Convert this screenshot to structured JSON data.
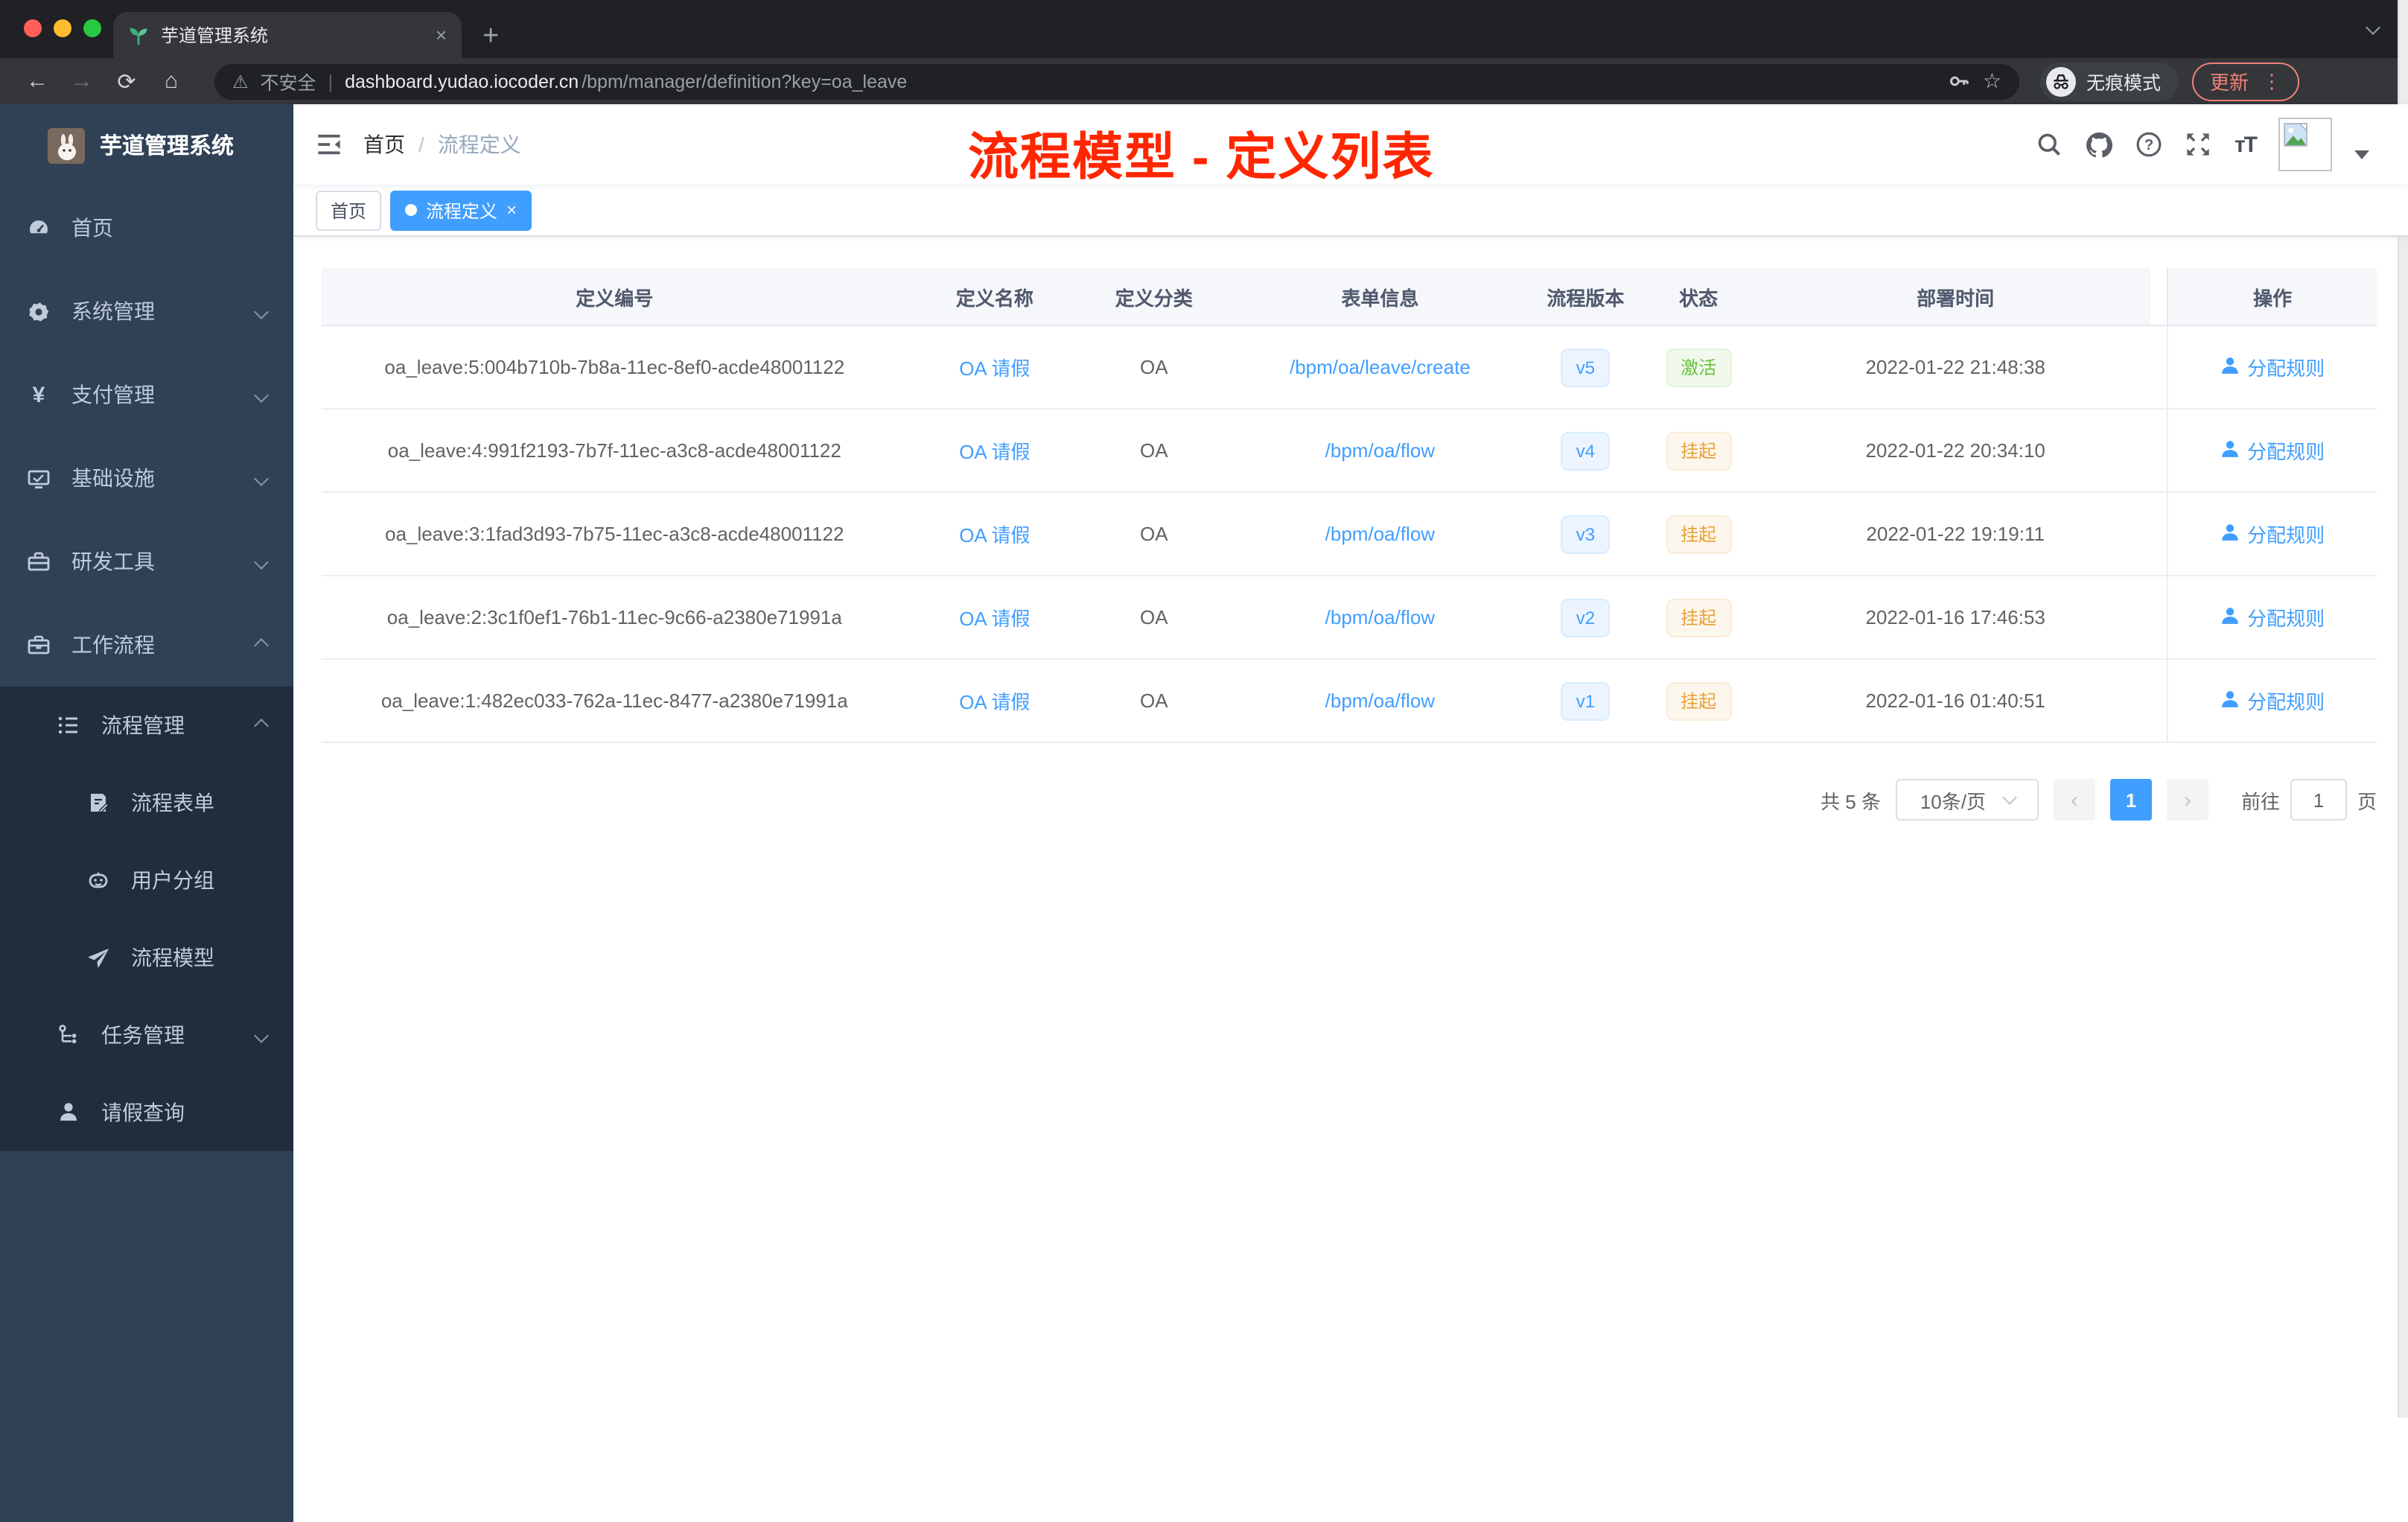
{
  "browser": {
    "tab": {
      "title": "芋道管理系统",
      "close": "×",
      "new_tab": "+"
    },
    "address": {
      "security": "不安全",
      "host": "dashboard.yudao.iocoder.cn",
      "path": "/bpm/manager/definition?key=oa_leave",
      "incognito": "无痕模式",
      "update": "更新",
      "menu_dots": "⋮",
      "star": "☆",
      "warn": "⚠",
      "back": "←",
      "forward": "→",
      "reload": "⟳",
      "home": "⌂"
    }
  },
  "sidebar": {
    "title": "芋道管理系统",
    "items": [
      {
        "label": "首页",
        "icon": "dashboard-icon"
      },
      {
        "label": "系统管理",
        "icon": "gear-icon"
      },
      {
        "label": "支付管理",
        "icon": "yen-icon"
      },
      {
        "label": "基础设施",
        "icon": "monitor-icon"
      },
      {
        "label": "研发工具",
        "icon": "toolbox-icon"
      },
      {
        "label": "工作流程",
        "icon": "briefcase-icon"
      },
      {
        "label": "流程管理",
        "icon": "list-icon"
      },
      {
        "label": "流程表单",
        "icon": "form-icon"
      },
      {
        "label": "用户分组",
        "icon": "robot-icon"
      },
      {
        "label": "流程模型",
        "icon": "paper-plane-icon"
      },
      {
        "label": "任务管理",
        "icon": "tree-icon"
      },
      {
        "label": "请假查询",
        "icon": "person-icon"
      }
    ]
  },
  "navbar": {
    "breadcrumb": {
      "home": "首页",
      "sep": "/",
      "current": "流程定义"
    },
    "annotation": "流程模型 - 定义列表"
  },
  "tags": {
    "home": "首页",
    "current": "流程定义"
  },
  "table": {
    "columns": [
      "定义编号",
      "定义名称",
      "定义分类",
      "表单信息",
      "流程版本",
      "状态",
      "部署时间",
      "操作"
    ],
    "rows": [
      {
        "id": "oa_leave:5:004b710b-7b8a-11ec-8ef0-acde48001122",
        "name": "OA 请假",
        "category": "OA",
        "form": "/bpm/oa/leave/create",
        "version": "v5",
        "status": "激活",
        "status_type": "success",
        "deploy_time": "2022-01-22 21:48:38",
        "action": "分配规则"
      },
      {
        "id": "oa_leave:4:991f2193-7b7f-11ec-a3c8-acde48001122",
        "name": "OA 请假",
        "category": "OA",
        "form": "/bpm/oa/flow",
        "version": "v4",
        "status": "挂起",
        "status_type": "warning",
        "deploy_time": "2022-01-22 20:34:10",
        "action": "分配规则"
      },
      {
        "id": "oa_leave:3:1fad3d93-7b75-11ec-a3c8-acde48001122",
        "name": "OA 请假",
        "category": "OA",
        "form": "/bpm/oa/flow",
        "version": "v3",
        "status": "挂起",
        "status_type": "warning",
        "deploy_time": "2022-01-22 19:19:11",
        "action": "分配规则"
      },
      {
        "id": "oa_leave:2:3c1f0ef1-76b1-11ec-9c66-a2380e71991a",
        "name": "OA 请假",
        "category": "OA",
        "form": "/bpm/oa/flow",
        "version": "v2",
        "status": "挂起",
        "status_type": "warning",
        "deploy_time": "2022-01-16 17:46:53",
        "action": "分配规则"
      },
      {
        "id": "oa_leave:1:482ec033-762a-11ec-8477-a2380e71991a",
        "name": "OA 请假",
        "category": "OA",
        "form": "/bpm/oa/flow",
        "version": "v1",
        "status": "挂起",
        "status_type": "warning",
        "deploy_time": "2022-01-16 01:40:51",
        "action": "分配规则"
      }
    ]
  },
  "pagination": {
    "total": "共 5 条",
    "page_size": "10条/页",
    "prev": "‹",
    "current": "1",
    "next": "›",
    "goto": "前往",
    "goto_value": "1",
    "unit": "页"
  },
  "colors": {
    "accent": "#409eff",
    "success": "#67c23a",
    "warning": "#e6a23c",
    "annotation_red": "#ff2600",
    "sidebar_bg": "#304156",
    "submenu_bg": "#1f2d3d"
  }
}
